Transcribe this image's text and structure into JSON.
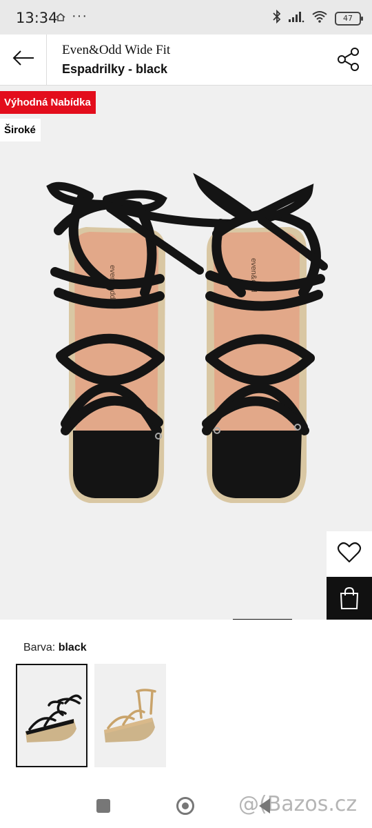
{
  "status_bar": {
    "time": "13:34",
    "dots": "···",
    "battery": "47"
  },
  "header": {
    "brand": "Even&Odd Wide Fit",
    "product_name": "Espadrilky - black",
    "icons": [
      "back-arrow-icon",
      "share-icon"
    ]
  },
  "hero": {
    "badges": [
      "Výhodná Nabídka",
      "Široké"
    ],
    "badge_color": "#e30d1c",
    "insole_brand": "even&odd",
    "image_index": 4,
    "image_count": 6,
    "buttons": [
      "wishlist-heart-icon",
      "shopping-bag-icon"
    ]
  },
  "color_selector": {
    "label": "Barva:",
    "selected": "black",
    "options": [
      "black",
      "gold"
    ]
  },
  "watermark": "@(Bazos.cz"
}
